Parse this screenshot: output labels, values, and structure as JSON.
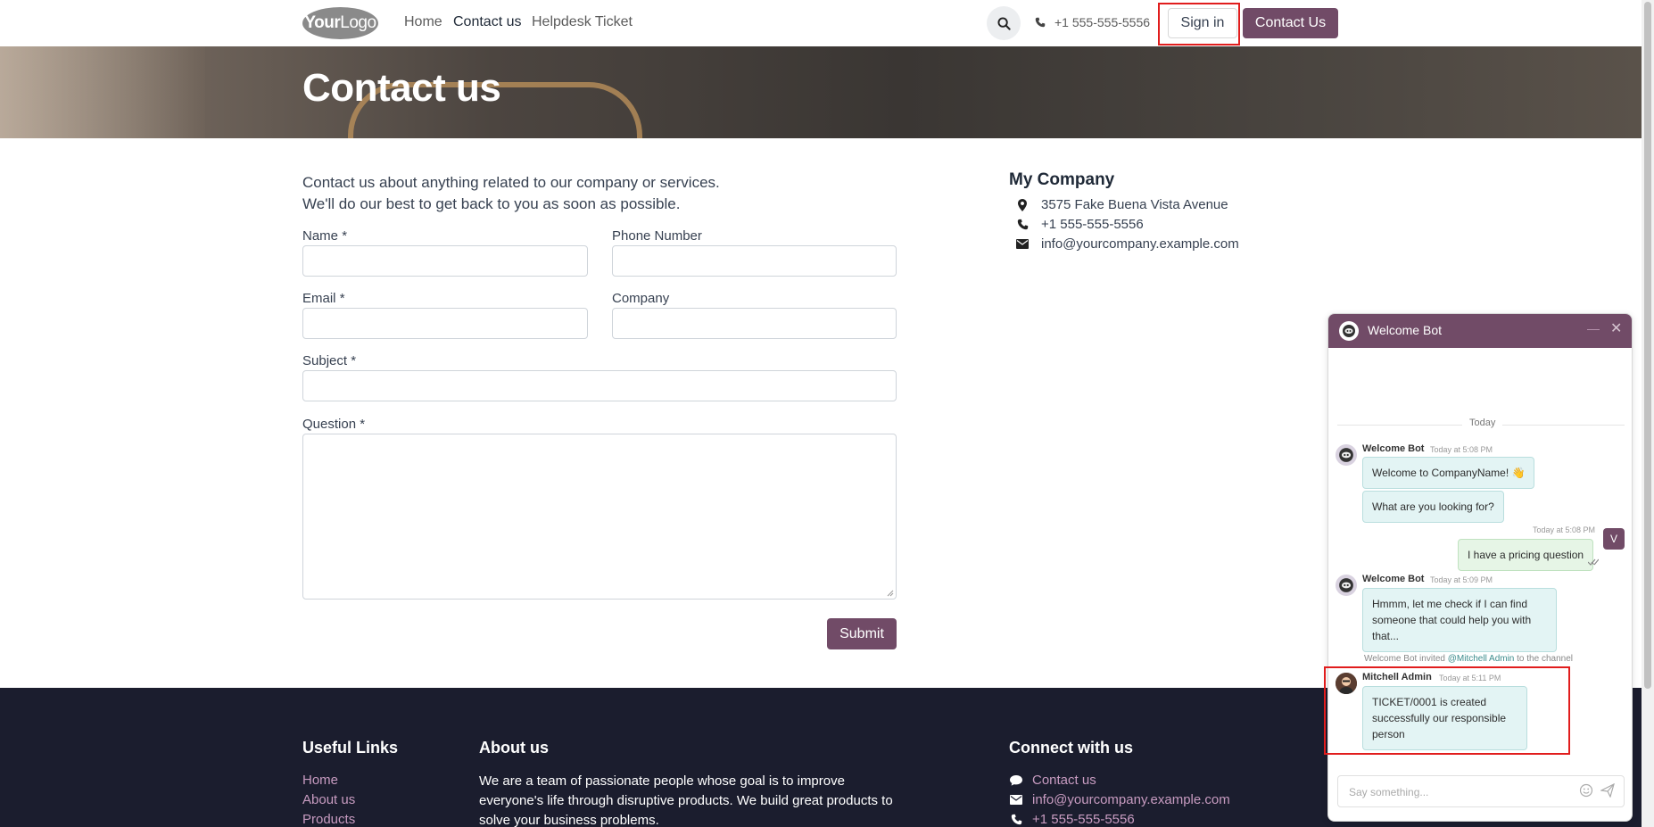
{
  "header": {
    "logo_bold": "Your",
    "logo_light": "Logo",
    "nav": [
      "Home",
      "Contact us",
      "Helpdesk Ticket"
    ],
    "phone": "+1 555-555-5556",
    "sign_in": "Sign in",
    "contact_us": "Contact Us"
  },
  "banner": {
    "title": "Contact us"
  },
  "form": {
    "intro_line1": "Contact us about anything related to our company or services.",
    "intro_line2": "We'll do our best to get back to you as soon as possible.",
    "name_label": "Name",
    "phone_label": "Phone Number",
    "email_label": "Email",
    "company_label": "Company",
    "subject_label": "Subject",
    "question_label": "Question",
    "required_mark": "*",
    "submit": "Submit"
  },
  "company": {
    "name": "My Company",
    "address": "3575 Fake Buena Vista Avenue",
    "phone": "+1 555-555-5556",
    "email": "info@yourcompany.example.com"
  },
  "footer": {
    "useful_links_title": "Useful Links",
    "links": [
      "Home",
      "About us",
      "Products"
    ],
    "about_title": "About us",
    "about_text": "We are a team of passionate people whose goal is to improve everyone's life through disruptive products. We build great products to solve your business problems.",
    "connect_title": "Connect with us",
    "connect_contact": "Contact us",
    "connect_email": "info@yourcompany.example.com",
    "connect_phone": "+1 555-555-5556"
  },
  "chat": {
    "title": "Welcome Bot",
    "day_separator": "Today",
    "messages": [
      {
        "author": "Welcome Bot",
        "time": "Today at 5:08 PM",
        "texts": [
          "Welcome to CompanyName! 👋",
          "What are you looking for?"
        ]
      },
      {
        "author": "V",
        "time": "Today at 5:08 PM",
        "texts": [
          "I have a pricing question"
        ]
      },
      {
        "author": "Welcome Bot",
        "time": "Today at 5:09 PM",
        "texts": [
          "Hmmm, let me check if I can find someone that could help you with that..."
        ]
      },
      {
        "author": "Mitchell Admin",
        "time": "Today at 5:11 PM",
        "texts": [
          "TICKET/0001 is created successfully our responsible person"
        ]
      }
    ],
    "invite_prefix": "Welcome Bot invited",
    "invite_mention": "@Mitchell Admin",
    "invite_suffix": "to the channel",
    "input_placeholder": "Say something..."
  },
  "colors": {
    "brand": "#714b67",
    "footer_bg": "#1b1d2e",
    "highlight": "#e11d1d"
  }
}
